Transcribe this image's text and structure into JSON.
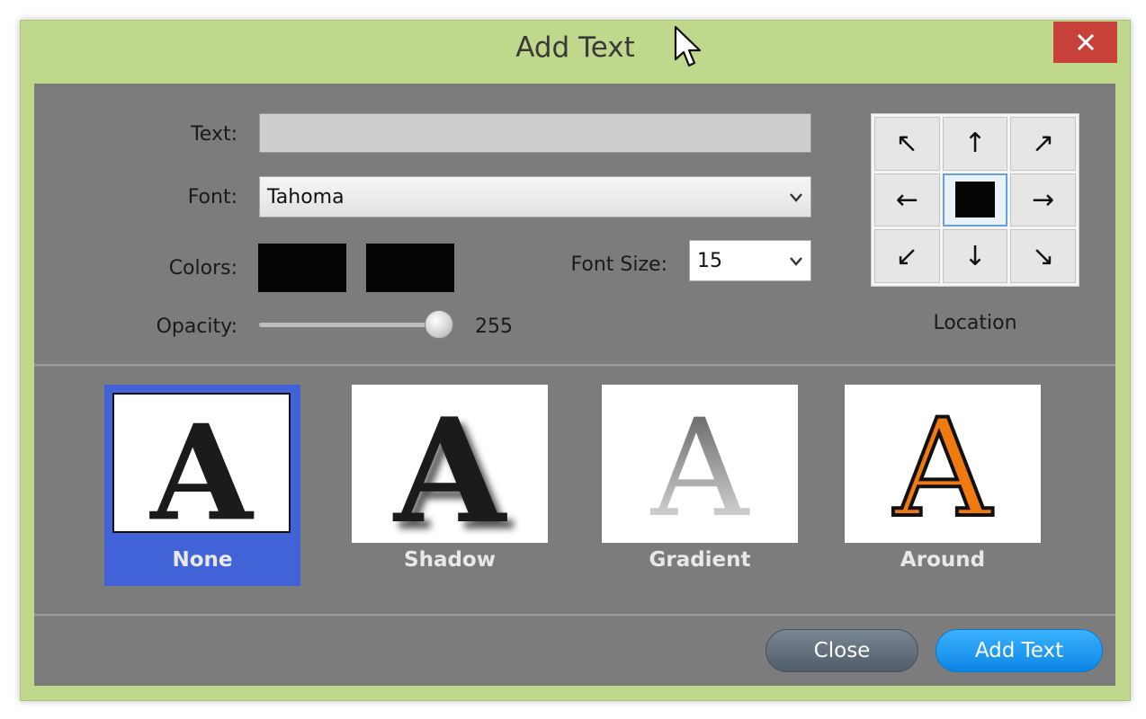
{
  "window": {
    "title": "Add Text",
    "close_icon": "close-x-icon"
  },
  "form": {
    "text_label": "Text:",
    "text_value": "",
    "font_label": "Font:",
    "font_value": "Tahoma",
    "colors_label": "Colors:",
    "color_primary": "#050505",
    "color_secondary": "#050505",
    "font_size_label": "Font Size:",
    "font_size_value": "15",
    "opacity_label": "Opacity:",
    "opacity_value": "255",
    "opacity_fraction": 1.0
  },
  "location": {
    "label": "Location",
    "arrows": [
      "↖",
      "↑",
      "↗",
      "←",
      "",
      "→",
      "↙",
      "↓",
      "↘"
    ],
    "selected": "center"
  },
  "effects": [
    {
      "name": "None",
      "selected": true
    },
    {
      "name": "Shadow",
      "selected": false
    },
    {
      "name": "Gradient",
      "selected": false
    },
    {
      "name": "Around",
      "selected": false
    }
  ],
  "buttons": {
    "close_label": "Close",
    "add_label": "Add Text"
  },
  "colors": {
    "window_frame": "#bfd88c",
    "panel": "#7c7c7c",
    "close_x": "#c7403a",
    "selected_effect": "#4262d8",
    "add_button": "#1a9bf2",
    "around_fill": "#f07a10"
  }
}
